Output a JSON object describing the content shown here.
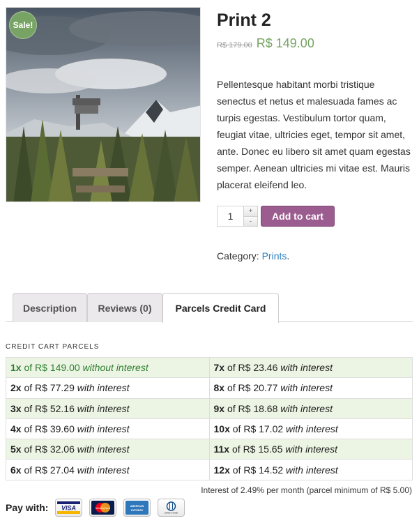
{
  "product": {
    "badge": "Sale!",
    "title": "Print 2",
    "price_old": "R$ 179.00",
    "price_new": "R$ 149.00",
    "description": "Pellentesque habitant morbi tristique senectus et netus et malesuada fames ac turpis egestas. Vestibulum tortor quam, feugiat vitae, ultricies eget, tempor sit amet, ante. Donec eu libero sit amet quam egestas semper. Aenean ultricies mi vitae est. Mauris placerat eleifend leo.",
    "quantity": "1",
    "qty_plus": "+",
    "qty_minus": "-",
    "add_to_cart": "Add to cart",
    "category_label": "Category:",
    "category_link": "Prints",
    "category_suffix": "."
  },
  "tabs": [
    {
      "label": "Description"
    },
    {
      "label": "Reviews (0)"
    },
    {
      "label": "Parcels Credit Card",
      "active": true
    }
  ],
  "parcels": {
    "title": "CREDIT CART PARCELS",
    "rows": [
      [
        {
          "n": "1x",
          "of": " of ",
          "amount": "R$ 149.00",
          "note": "without interest"
        },
        {
          "n": "7x",
          "of": " of ",
          "amount": "R$ 23.46",
          "note": "with interest"
        }
      ],
      [
        {
          "n": "2x",
          "of": " of ",
          "amount": "R$ 77.29",
          "note": "with interest"
        },
        {
          "n": "8x",
          "of": " of ",
          "amount": "R$ 20.77",
          "note": "with interest"
        }
      ],
      [
        {
          "n": "3x",
          "of": " of ",
          "amount": "R$ 52.16",
          "note": "with interest"
        },
        {
          "n": "9x",
          "of": " of ",
          "amount": "R$ 18.68",
          "note": "with interest"
        }
      ],
      [
        {
          "n": "4x",
          "of": " of ",
          "amount": "R$ 39.60",
          "note": "with interest"
        },
        {
          "n": "10x",
          "of": " of ",
          "amount": "R$ 17.02",
          "note": "with interest"
        }
      ],
      [
        {
          "n": "5x",
          "of": " of ",
          "amount": "R$ 32.06",
          "note": "with interest"
        },
        {
          "n": "11x",
          "of": " of ",
          "amount": "R$ 15.65",
          "note": "with interest"
        }
      ],
      [
        {
          "n": "6x",
          "of": " of ",
          "amount": "R$ 27.04",
          "note": "with interest"
        },
        {
          "n": "12x",
          "of": " of ",
          "amount": "R$ 14.52",
          "note": "with interest"
        }
      ]
    ],
    "note": "Interest of 2.49% per month (parcel minimum of R$ 5.00)"
  },
  "pay_with": {
    "label": "Pay with:",
    "cards": [
      {
        "name": "visa",
        "icon": "visa-card-icon",
        "text": "VISA"
      },
      {
        "name": "mastercard",
        "icon": "mastercard-card-icon",
        "text": "MasterCard"
      },
      {
        "name": "amex",
        "icon": "amex-card-icon",
        "text": "AMERICAN EXPRESS"
      },
      {
        "name": "diners",
        "icon": "diners-club-card-icon",
        "text": "Diners Club"
      }
    ]
  },
  "colors": {
    "sale_green": "#77a464",
    "button_purple": "#9b5c8f",
    "link_blue": "#2a7fc0",
    "row_highlight": "#ecf5e3"
  }
}
